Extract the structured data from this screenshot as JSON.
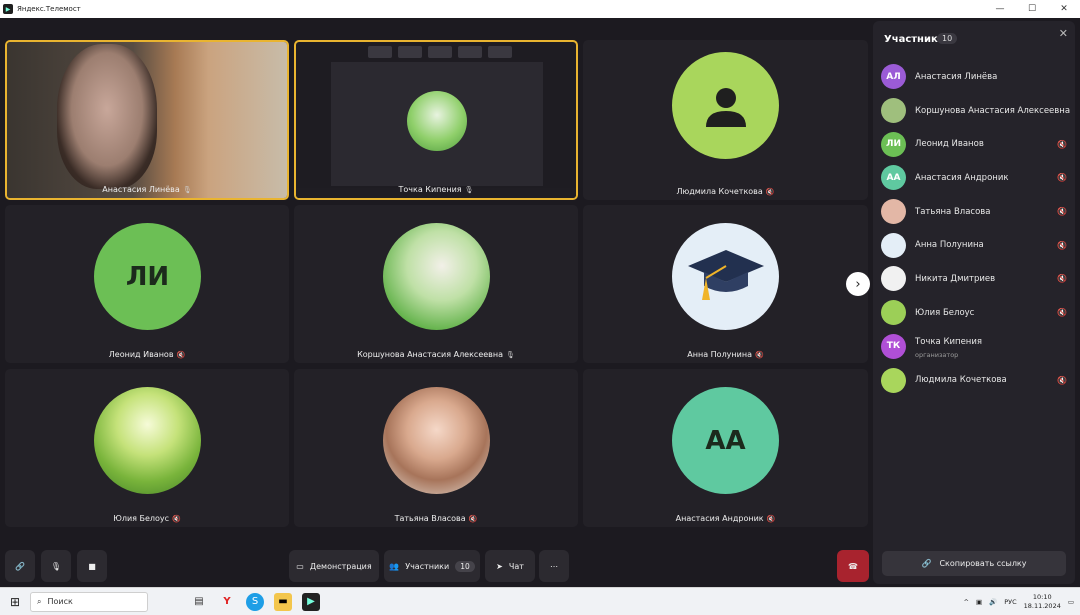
{
  "window": {
    "title": "Яндекс.Телемост",
    "app_icon": "telemost-icon",
    "controls": [
      "—",
      "☐",
      "✕"
    ]
  },
  "tiles": [
    {
      "name": "Анастасия Линёва",
      "kind": "camera",
      "mic": "mic-icon",
      "active": true
    },
    {
      "name": "Точка Кипения",
      "kind": "screenshare",
      "mic": "mic-icon",
      "active": true
    },
    {
      "name": "Людмила Кочеткова",
      "kind": "avatar",
      "avatar": "person-silhouette-icon",
      "color": "#a9d65c",
      "mic": "mic-muted-icon"
    },
    {
      "name": "Леонид Иванов",
      "kind": "initials",
      "initials": "ЛИ",
      "color": "#6cbf55",
      "mic": "mic-muted-icon"
    },
    {
      "name": "Коршунова Анастасия Алексеевна",
      "kind": "photo",
      "mic": "mic-icon"
    },
    {
      "name": "Анна Полунина",
      "kind": "photo",
      "avatar": "graduation-cap-icon",
      "mic": "mic-muted-icon"
    },
    {
      "name": "Юлия Белоус",
      "kind": "photo",
      "mic": "mic-muted-icon"
    },
    {
      "name": "Татьяна Власова",
      "kind": "photo",
      "mic": "mic-muted-icon"
    },
    {
      "name": "Анастасия Андроник",
      "kind": "initials",
      "initials": "АА",
      "color": "#5fc9a0",
      "mic": "mic-muted-icon"
    }
  ],
  "participants_panel": {
    "title": "Участники",
    "count": "10",
    "items": [
      {
        "name": "Анастасия Линёва",
        "initials": "АЛ",
        "color": "#9b5bd6",
        "muted": false
      },
      {
        "name": "Коршунова Анастасия Алексеевна",
        "initials": "",
        "color": "#9fbf7d",
        "muted": false
      },
      {
        "name": "Леонид Иванов",
        "initials": "ЛИ",
        "color": "#6cbf55",
        "muted": true
      },
      {
        "name": "Анастасия Андроник",
        "initials": "АА",
        "color": "#5fc9a0",
        "muted": true
      },
      {
        "name": "Татьяна Власова",
        "initials": "",
        "color": "#e3b7a6",
        "muted": true
      },
      {
        "name": "Анна Полунина",
        "initials": "",
        "color": "#e4eef7",
        "muted": true
      },
      {
        "name": "Никита Дмитриев",
        "initials": "",
        "color": "#f1f1f1",
        "muted": true
      },
      {
        "name": "Юлия Белоус",
        "initials": "",
        "color": "#9ccf57",
        "muted": true
      },
      {
        "name": "Точка Кипения",
        "initials": "ТК",
        "color": "#b04fd6",
        "muted": false,
        "role": "организатор"
      },
      {
        "name": "Людмила Кочеткова",
        "initials": "",
        "color": "#a9d65c",
        "muted": true
      }
    ],
    "copy_link_label": "Скопировать ссылку"
  },
  "toolbar": {
    "demo_label": "Демонстрация",
    "participants_label": "Участники",
    "participants_count": "10",
    "chat_label": "Чат",
    "more_label": "⋯"
  },
  "taskbar": {
    "search_placeholder": "Поиск",
    "lang": "РУС",
    "time": "10:10",
    "date": "18.11.2024"
  }
}
